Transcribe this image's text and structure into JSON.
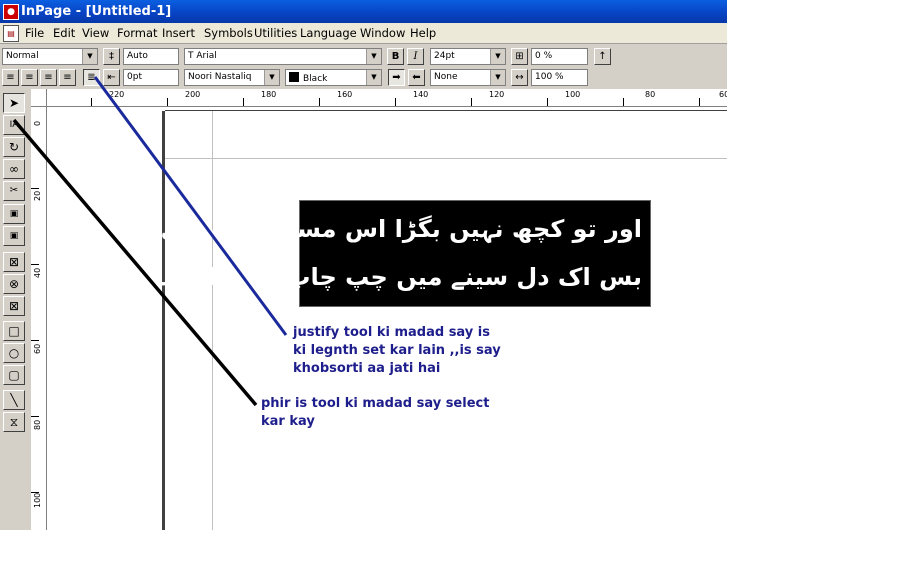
{
  "window": {
    "title": "InPage - [Untitled-1]",
    "app_icon": "inpage-logo"
  },
  "menu": [
    "File",
    "Edit",
    "View",
    "Format",
    "Insert",
    "Symbols",
    "Utilities",
    "Language",
    "Window",
    "Help"
  ],
  "toolbar": {
    "style": "Normal",
    "leading": "Auto",
    "font_english": "Arial",
    "font_size": "24pt",
    "tracking": "0 %",
    "indent": "0pt",
    "font_urdu": "Noori Nastaliq",
    "color": "Black",
    "shade": "None",
    "scale": "100 %",
    "bold_label": "B",
    "italic_label": "I",
    "active_alignment": "justify"
  },
  "ruler": {
    "h_labels": [
      "220",
      "200",
      "180",
      "160",
      "140",
      "120",
      "100",
      "80",
      "60"
    ],
    "v_labels": [
      "0",
      "20",
      "40",
      "60",
      "80",
      "100"
    ]
  },
  "document": {
    "urdu_line1": "اور تو کچھ نہیں بگڑا اس مسلسل جدائی سے",
    "urdu_line2": "بس اک دل سینے میں چپ چاپ مرنے لگا ہے"
  },
  "annotations": {
    "note1": "justify tool ki madad say is ki legnth set kar lain ,,is say khobsorti aa jati hai",
    "note2": "phir is tool ki madad say select kar kay"
  },
  "colors": {
    "arrow_blue": "#1a2a9c",
    "arrow_black": "#000000",
    "note_text": "#1e1e8c"
  }
}
